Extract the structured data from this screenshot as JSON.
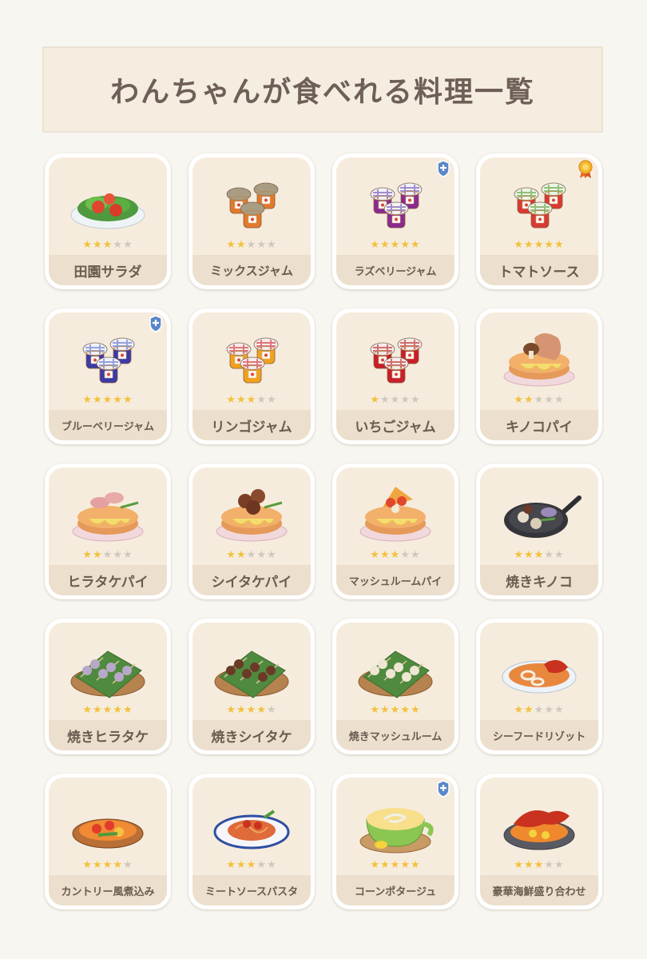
{
  "title": "わんちゃんが食べれる料理一覧",
  "colors": {
    "star_on": "#f2c13d",
    "star_off": "#cfc8bf",
    "label_bg": "#ecdfcd",
    "card_bg": "#f6ecdd"
  },
  "items": [
    {
      "name": "田園サラダ",
      "stars": 3,
      "dish": "salad",
      "badge": null
    },
    {
      "name": "ミックスジャム",
      "stars": 2,
      "dish": "jam-plain",
      "badge": null
    },
    {
      "name": "ラズベリージャム",
      "stars": 5,
      "dish": "jam-purple",
      "badge": "plus-badge-icon"
    },
    {
      "name": "トマトソース",
      "stars": 5,
      "dish": "jam-green",
      "badge": "medal-icon"
    },
    {
      "name": "ブルーベリージャム",
      "stars": 5,
      "dish": "jam-blue",
      "badge": "plus-badge-icon"
    },
    {
      "name": "リンゴジャム",
      "stars": 3,
      "dish": "jam-red",
      "badge": null
    },
    {
      "name": "いちごジャム",
      "stars": 1,
      "dish": "jam-strawberry",
      "badge": null
    },
    {
      "name": "キノコパイ",
      "stars": 2,
      "dish": "pie-mushroom",
      "badge": null
    },
    {
      "name": "ヒラタケパイ",
      "stars": 2,
      "dish": "pie-oyster",
      "badge": null
    },
    {
      "name": "シイタケパイ",
      "stars": 2,
      "dish": "pie-shiitake",
      "badge": null
    },
    {
      "name": "マッシュルームパイ",
      "stars": 3,
      "dish": "pie-tomato",
      "badge": null
    },
    {
      "name": "焼きキノコ",
      "stars": 3,
      "dish": "pan-mushroom",
      "badge": null
    },
    {
      "name": "焼きヒラタケ",
      "stars": 5,
      "dish": "skewer-oyster",
      "badge": null
    },
    {
      "name": "焼きシイタケ",
      "stars": 4,
      "dish": "skewer-shiitake",
      "badge": null
    },
    {
      "name": "焼きマッシュルーム",
      "stars": 5,
      "dish": "skewer-mushroom",
      "badge": null
    },
    {
      "name": "シーフードリゾット",
      "stars": 2,
      "dish": "risotto",
      "badge": null
    },
    {
      "name": "カントリー風煮込み",
      "stars": 4,
      "dish": "stew",
      "badge": null
    },
    {
      "name": "ミートソースパスタ",
      "stars": 3,
      "dish": "pasta",
      "badge": null
    },
    {
      "name": "コーンポタージュ",
      "stars": 5,
      "dish": "soup",
      "badge": "plus-badge-icon"
    },
    {
      "name": "豪華海鮮盛り合わせ",
      "stars": 3,
      "dish": "seafood-platter",
      "badge": null
    }
  ]
}
